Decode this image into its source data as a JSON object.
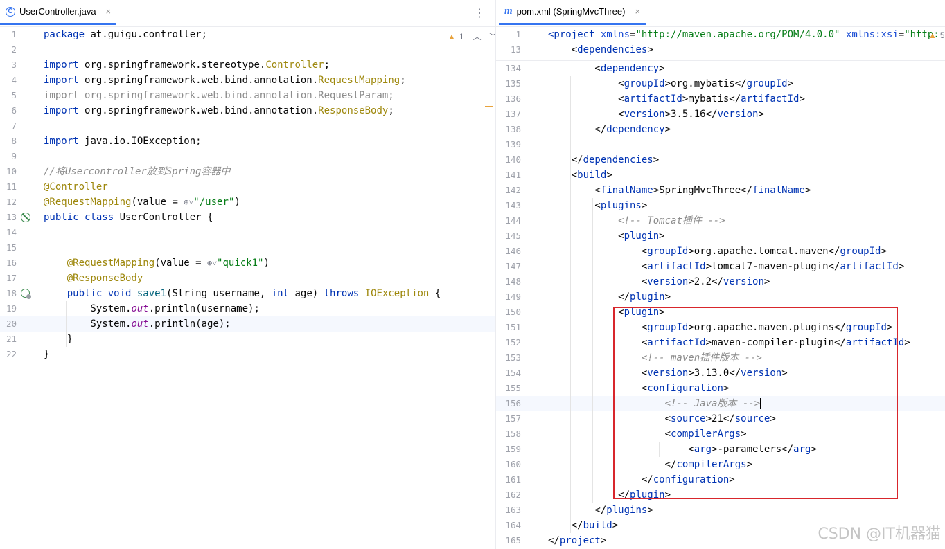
{
  "left": {
    "tab": {
      "icon": "class-icon",
      "label": "UserController.java",
      "close": "×"
    },
    "menu": "⋮",
    "inspections": {
      "warnings": "1"
    },
    "lines": [
      {
        "n": "1",
        "parts": [
          [
            "kw",
            "package "
          ],
          [
            "plain",
            "at.guigu.controller;"
          ]
        ]
      },
      {
        "n": "2",
        "parts": []
      },
      {
        "n": "3",
        "parts": [
          [
            "kw",
            "import "
          ],
          [
            "plain",
            "org.springframework.stereotype."
          ],
          [
            "typ",
            "Controller"
          ],
          [
            "plain",
            ";"
          ]
        ]
      },
      {
        "n": "4",
        "parts": [
          [
            "kw",
            "import "
          ],
          [
            "plain",
            "org.springframework.web.bind.annotation."
          ],
          [
            "typ",
            "RequestMapping"
          ],
          [
            "plain",
            ";"
          ]
        ]
      },
      {
        "n": "5",
        "parts": [
          [
            "unused",
            "import org.springframework.web.bind.annotation.RequestParam;"
          ]
        ]
      },
      {
        "n": "6",
        "parts": [
          [
            "kw",
            "import "
          ],
          [
            "plain",
            "org.springframework.web.bind.annotation."
          ],
          [
            "typ",
            "ResponseBody"
          ],
          [
            "plain",
            ";"
          ]
        ]
      },
      {
        "n": "7",
        "parts": []
      },
      {
        "n": "8",
        "parts": [
          [
            "kw",
            "import "
          ],
          [
            "plain",
            "java.io.IOException;"
          ]
        ]
      },
      {
        "n": "9",
        "parts": []
      },
      {
        "n": "10",
        "parts": [
          [
            "cm",
            "//将Usercontroller放到Spring容器中"
          ]
        ]
      },
      {
        "n": "11",
        "parts": [
          [
            "ann",
            "@Controller"
          ]
        ]
      },
      {
        "n": "12",
        "parts": [
          [
            "ann",
            "@RequestMapping"
          ],
          [
            "plain",
            "(value = "
          ],
          [
            "globe",
            "⊕˅"
          ],
          [
            "str",
            "\""
          ],
          [
            "strul",
            "/user"
          ],
          [
            "str",
            "\""
          ],
          [
            "plain",
            ")"
          ]
        ]
      },
      {
        "n": "13",
        "parts": [
          [
            "kw",
            "public class "
          ],
          [
            "plain",
            "UserController {"
          ]
        ]
      },
      {
        "n": "14",
        "parts": []
      },
      {
        "n": "15",
        "parts": []
      },
      {
        "n": "16",
        "parts": [
          [
            "plain",
            "    "
          ],
          [
            "ann",
            "@RequestMapping"
          ],
          [
            "plain",
            "(value = "
          ],
          [
            "globe",
            "⊕˅"
          ],
          [
            "str",
            "\""
          ],
          [
            "strul",
            "quick1"
          ],
          [
            "str",
            "\""
          ],
          [
            "plain",
            ")"
          ]
        ]
      },
      {
        "n": "17",
        "parts": [
          [
            "plain",
            "    "
          ],
          [
            "ann",
            "@ResponseBody"
          ]
        ]
      },
      {
        "n": "18",
        "parts": [
          [
            "plain",
            "    "
          ],
          [
            "kw",
            "public void "
          ],
          [
            "meth",
            "save1"
          ],
          [
            "plain",
            "(String username, "
          ],
          [
            "kw",
            "int "
          ],
          [
            "plain",
            "age) "
          ],
          [
            "kw",
            "throws "
          ],
          [
            "typ",
            "IOException"
          ],
          [
            "plain",
            " {"
          ]
        ]
      },
      {
        "n": "19",
        "parts": [
          [
            "plain",
            "        System."
          ],
          [
            "it",
            "out"
          ],
          [
            "plain",
            ".println(username);"
          ]
        ]
      },
      {
        "n": "20",
        "parts": [
          [
            "plain",
            "        System."
          ],
          [
            "it",
            "out"
          ],
          [
            "plain",
            ".println(age);"
          ]
        ]
      },
      {
        "n": "21",
        "parts": [
          [
            "plain",
            "    }"
          ]
        ]
      },
      {
        "n": "22",
        "parts": [
          [
            "plain",
            "}"
          ]
        ]
      }
    ]
  },
  "right": {
    "tab": {
      "icon": "maven-icon",
      "label": "pom.xml (SpringMvcThree)",
      "close": "×"
    },
    "inspections": {
      "warnings": "5"
    },
    "sticky": [
      {
        "n": "1",
        "parts": [
          [
            "tag",
            "<project "
          ],
          [
            "attr",
            "xmlns"
          ],
          [
            "plain",
            "="
          ],
          [
            "aval",
            "\"http://maven.apache.org/POM/4.0.0\""
          ],
          [
            "plain",
            " "
          ],
          [
            "attr",
            "xmlns:xsi"
          ],
          [
            "plain",
            "="
          ],
          [
            "aval",
            "\"http:"
          ]
        ]
      },
      {
        "n": "13",
        "parts": [
          [
            "plain",
            "    <"
          ],
          [
            "tag",
            "dependencies"
          ],
          [
            "plain",
            ">"
          ]
        ]
      }
    ],
    "lines": [
      {
        "n": "134",
        "parts": [
          [
            "plain",
            "        <"
          ],
          [
            "tag",
            "dependency"
          ],
          [
            "plain",
            ">"
          ]
        ]
      },
      {
        "n": "135",
        "parts": [
          [
            "plain",
            "            <"
          ],
          [
            "tag",
            "groupId"
          ],
          [
            "plain",
            ">org.mybatis</"
          ],
          [
            "tag",
            "groupId"
          ],
          [
            "plain",
            ">"
          ]
        ]
      },
      {
        "n": "136",
        "parts": [
          [
            "plain",
            "            <"
          ],
          [
            "tag",
            "artifactId"
          ],
          [
            "plain",
            ">mybatis</"
          ],
          [
            "tag",
            "artifactId"
          ],
          [
            "plain",
            ">"
          ]
        ]
      },
      {
        "n": "137",
        "parts": [
          [
            "plain",
            "            <"
          ],
          [
            "tag",
            "version"
          ],
          [
            "plain",
            ">3.5.16</"
          ],
          [
            "tag",
            "version"
          ],
          [
            "plain",
            ">"
          ]
        ]
      },
      {
        "n": "138",
        "parts": [
          [
            "plain",
            "        </"
          ],
          [
            "tag",
            "dependency"
          ],
          [
            "plain",
            ">"
          ]
        ]
      },
      {
        "n": "139",
        "parts": []
      },
      {
        "n": "140",
        "parts": [
          [
            "plain",
            "    </"
          ],
          [
            "tag",
            "dependencies"
          ],
          [
            "plain",
            ">"
          ]
        ]
      },
      {
        "n": "141",
        "parts": [
          [
            "plain",
            "    <"
          ],
          [
            "tag",
            "build"
          ],
          [
            "plain",
            ">"
          ]
        ]
      },
      {
        "n": "142",
        "parts": [
          [
            "plain",
            "        <"
          ],
          [
            "tag",
            "finalName"
          ],
          [
            "plain",
            ">SpringMvcThree</"
          ],
          [
            "tag",
            "finalName"
          ],
          [
            "plain",
            ">"
          ]
        ]
      },
      {
        "n": "143",
        "parts": [
          [
            "plain",
            "        <"
          ],
          [
            "tag",
            "plugins"
          ],
          [
            "plain",
            ">"
          ]
        ]
      },
      {
        "n": "144",
        "parts": [
          [
            "plain",
            "            "
          ],
          [
            "cm",
            "<!-- Tomcat插件 -->"
          ]
        ]
      },
      {
        "n": "145",
        "parts": [
          [
            "plain",
            "            <"
          ],
          [
            "tag",
            "plugin"
          ],
          [
            "plain",
            ">"
          ]
        ]
      },
      {
        "n": "146",
        "parts": [
          [
            "plain",
            "                <"
          ],
          [
            "tag",
            "groupId"
          ],
          [
            "plain",
            ">org.apache.tomcat.maven</"
          ],
          [
            "tag",
            "groupId"
          ],
          [
            "plain",
            ">"
          ]
        ]
      },
      {
        "n": "147",
        "parts": [
          [
            "plain",
            "                <"
          ],
          [
            "tag",
            "artifactId"
          ],
          [
            "plain",
            ">tomcat7-maven-plugin</"
          ],
          [
            "tag",
            "artifactId"
          ],
          [
            "plain",
            ">"
          ]
        ]
      },
      {
        "n": "148",
        "parts": [
          [
            "plain",
            "                <"
          ],
          [
            "tag",
            "version"
          ],
          [
            "plain",
            ">2.2</"
          ],
          [
            "tag",
            "version"
          ],
          [
            "plain",
            ">"
          ]
        ]
      },
      {
        "n": "149",
        "parts": [
          [
            "plain",
            "            </"
          ],
          [
            "tag",
            "plugin"
          ],
          [
            "plain",
            ">"
          ]
        ]
      },
      {
        "n": "150",
        "parts": [
          [
            "plain",
            "            <"
          ],
          [
            "tag",
            "plugin"
          ],
          [
            "plain",
            ">"
          ]
        ]
      },
      {
        "n": "151",
        "parts": [
          [
            "plain",
            "                <"
          ],
          [
            "tag",
            "groupId"
          ],
          [
            "plain",
            ">org.apache.maven.plugins</"
          ],
          [
            "tag",
            "groupId"
          ],
          [
            "plain",
            ">"
          ]
        ]
      },
      {
        "n": "152",
        "parts": [
          [
            "plain",
            "                <"
          ],
          [
            "tag",
            "artifactId"
          ],
          [
            "plain",
            ">maven-compiler-plugin</"
          ],
          [
            "tag",
            "artifactId"
          ],
          [
            "plain",
            ">"
          ]
        ]
      },
      {
        "n": "153",
        "parts": [
          [
            "plain",
            "                "
          ],
          [
            "cm",
            "<!-- maven插件版本 -->"
          ]
        ]
      },
      {
        "n": "154",
        "parts": [
          [
            "plain",
            "                <"
          ],
          [
            "tag",
            "version"
          ],
          [
            "plain",
            ">3.13.0</"
          ],
          [
            "tag",
            "version"
          ],
          [
            "plain",
            ">"
          ]
        ]
      },
      {
        "n": "155",
        "parts": [
          [
            "plain",
            "                <"
          ],
          [
            "tag",
            "configuration"
          ],
          [
            "plain",
            ">"
          ]
        ]
      },
      {
        "n": "156",
        "parts": [
          [
            "plain",
            "                    "
          ],
          [
            "cm",
            "<!-- Java版本 -->"
          ]
        ]
      },
      {
        "n": "157",
        "parts": [
          [
            "plain",
            "                    <"
          ],
          [
            "tag",
            "source"
          ],
          [
            "plain",
            ">21</"
          ],
          [
            "tag",
            "source"
          ],
          [
            "plain",
            ">"
          ]
        ]
      },
      {
        "n": "158",
        "parts": [
          [
            "plain",
            "                    <"
          ],
          [
            "tag",
            "compilerArgs"
          ],
          [
            "plain",
            ">"
          ]
        ]
      },
      {
        "n": "159",
        "parts": [
          [
            "plain",
            "                        <"
          ],
          [
            "tag",
            "arg"
          ],
          [
            "plain",
            ">-parameters</"
          ],
          [
            "tag",
            "arg"
          ],
          [
            "plain",
            ">"
          ]
        ]
      },
      {
        "n": "160",
        "parts": [
          [
            "plain",
            "                    </"
          ],
          [
            "tag",
            "compilerArgs"
          ],
          [
            "plain",
            ">"
          ]
        ]
      },
      {
        "n": "161",
        "parts": [
          [
            "plain",
            "                </"
          ],
          [
            "tag",
            "configuration"
          ],
          [
            "plain",
            ">"
          ]
        ]
      },
      {
        "n": "162",
        "parts": [
          [
            "plain",
            "            </"
          ],
          [
            "tag",
            "plugin"
          ],
          [
            "plain",
            ">"
          ]
        ]
      },
      {
        "n": "163",
        "parts": [
          [
            "plain",
            "        </"
          ],
          [
            "tag",
            "plugins"
          ],
          [
            "plain",
            ">"
          ]
        ]
      },
      {
        "n": "164",
        "parts": [
          [
            "plain",
            "    </"
          ],
          [
            "tag",
            "build"
          ],
          [
            "plain",
            ">"
          ]
        ]
      },
      {
        "n": "165",
        "parts": [
          [
            "plain",
            "</"
          ],
          [
            "tag",
            "project"
          ],
          [
            "plain",
            ">"
          ]
        ]
      }
    ]
  },
  "watermark": "CSDN @IT机器猫"
}
